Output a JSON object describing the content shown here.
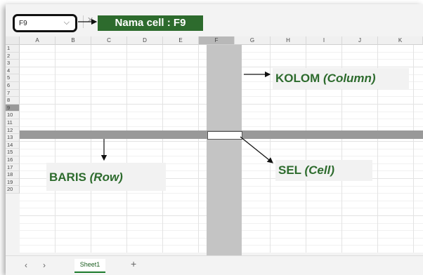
{
  "namebox": {
    "value": "F9",
    "chevron": "⌵"
  },
  "formula": {
    "x_icon": "✕"
  },
  "labels": {
    "nama_cell": "Nama cell : F9",
    "kolom": "KOLOM ",
    "kolom_em": "(Column)",
    "baris": "BARIS ",
    "baris_em": "(Row)",
    "sel": "SEL ",
    "sel_em": "(Cell)"
  },
  "columns": [
    "A",
    "B",
    "C",
    "D",
    "E",
    "F",
    "G",
    "H",
    "I",
    "J",
    "K"
  ],
  "rows": [
    "1",
    "2",
    "3",
    "4",
    "5",
    "6",
    "7",
    "8",
    "9",
    "10",
    "11",
    "12",
    "13",
    "14",
    "15",
    "16",
    "17",
    "18",
    "19",
    "20"
  ],
  "tabs": {
    "prev": "‹",
    "next": "›",
    "sheet": "Sheet1",
    "add": "+"
  },
  "colors": {
    "accent": "#2d6b2d",
    "column_highlight": "#c4c4c4",
    "row_highlight": "#999999"
  }
}
